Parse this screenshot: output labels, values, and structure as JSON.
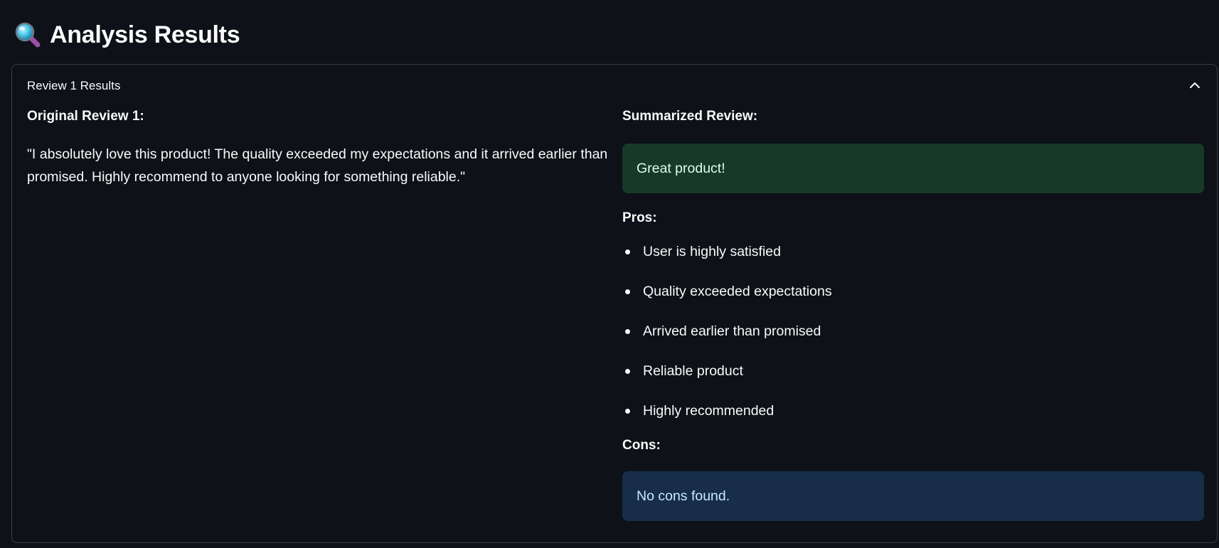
{
  "header": {
    "icon": "magnifying-glass-icon",
    "title": "Analysis Results"
  },
  "expander": {
    "label": "Review 1 Results",
    "expanded": true,
    "toggle_icon": "chevron-up-icon"
  },
  "original": {
    "heading": "Original Review 1:",
    "text": "\"I absolutely love this product! The quality exceeded my expectations and it arrived earlier than promised. Highly recommend to anyone looking for something reliable.\""
  },
  "summary": {
    "heading": "Summarized Review:",
    "text": "Great product!"
  },
  "pros": {
    "heading": "Pros:",
    "items": [
      "User is highly satisfied",
      "Quality exceeded expectations",
      "Arrived earlier than promised",
      "Reliable product",
      "Highly recommended"
    ]
  },
  "cons": {
    "heading": "Cons:",
    "text": "No cons found."
  },
  "colors": {
    "background": "#0e1117",
    "success_bg": "#173928",
    "success_text": "#dffde9",
    "info_bg": "#172d48",
    "info_text": "#c7ebff",
    "border": "#3a3d47"
  }
}
